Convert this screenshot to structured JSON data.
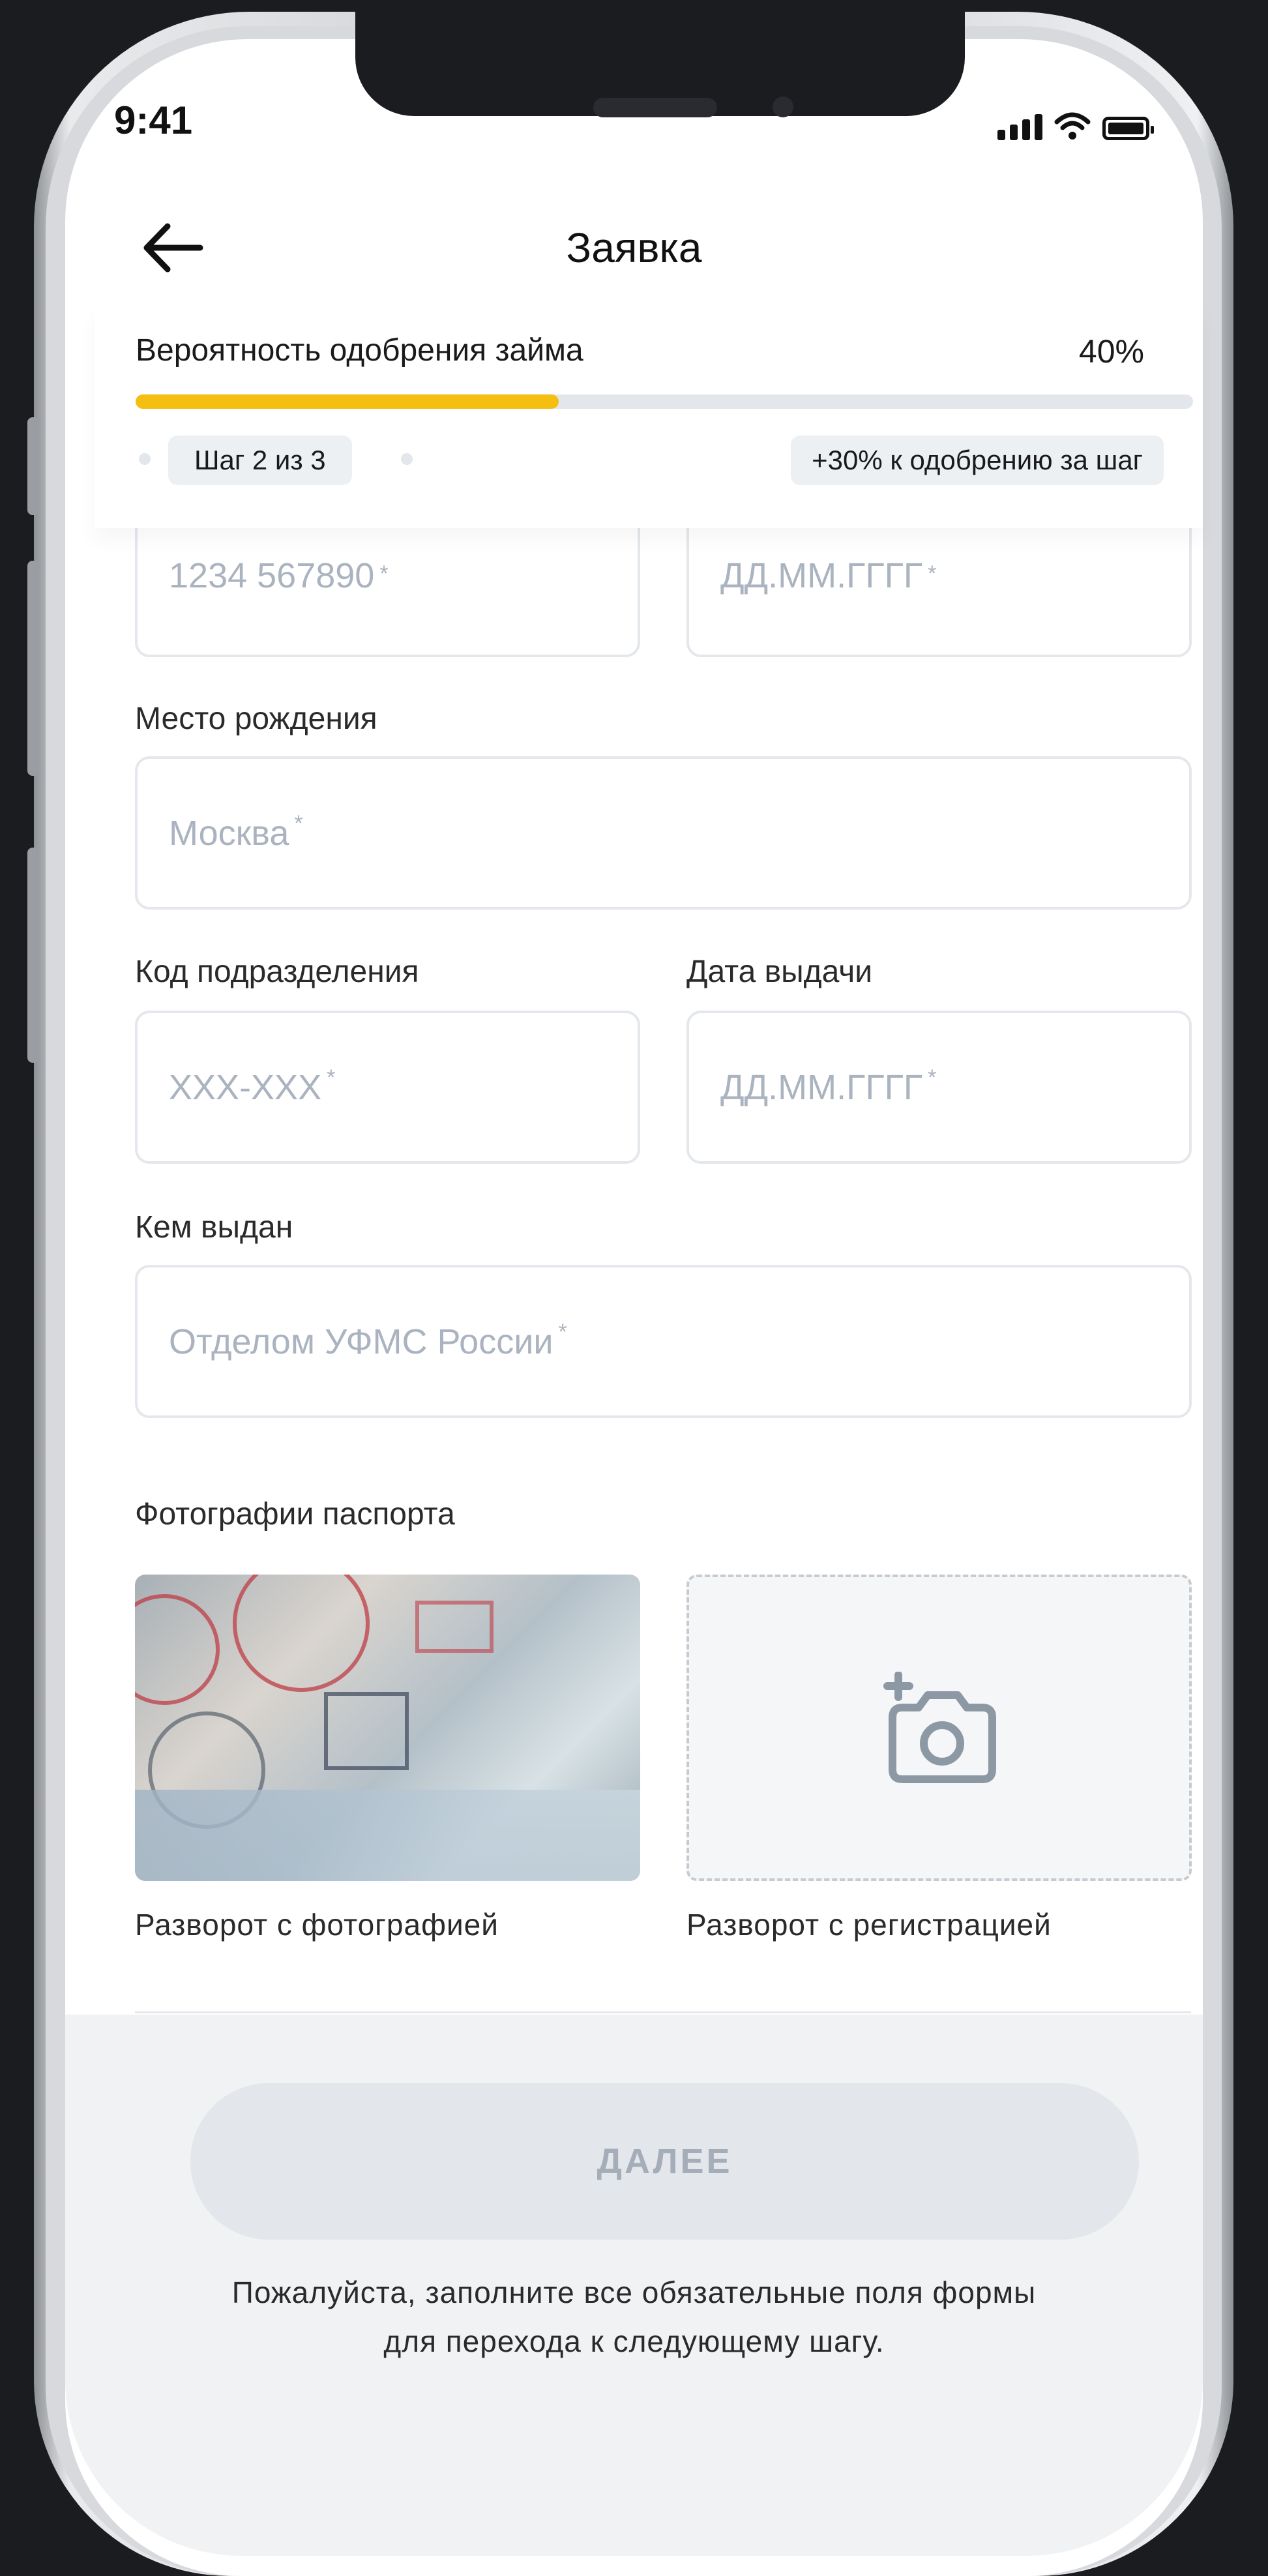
{
  "status_bar": {
    "time": "9:41"
  },
  "header": {
    "title": "Заявка"
  },
  "progress": {
    "label": "Вероятность одобрения займа",
    "percent_text": "40%",
    "value": 0.4,
    "step": "Шаг 2 из 3",
    "bonus": "+30% к одобрению за шаг"
  },
  "form": {
    "passport_number": {
      "placeholder": "1234 567890"
    },
    "birth_date": {
      "placeholder": "ДД.ММ.ГГГГ"
    },
    "birth_place": {
      "label": "Место рождения",
      "placeholder": "Москва"
    },
    "division_code": {
      "label": "Код подразделения",
      "placeholder": "XXX-XXX"
    },
    "issue_date": {
      "label": "Дата выдачи",
      "placeholder": "ДД.ММ.ГГГГ"
    },
    "issued_by": {
      "label": "Кем выдан",
      "placeholder": "Отделом УФМС России"
    },
    "required_mark": "*"
  },
  "photos": {
    "title": "Фотографии паспорта",
    "photo_page_caption": "Разворот с фотографией",
    "registration_page_caption": "Разворот с регистрацией",
    "upload_icon": "add-photo-camera-icon"
  },
  "footer": {
    "next_label": "ДАЛЕЕ",
    "hint_line1": "Пожалуйста, заполните все обязательные поля формы",
    "hint_line2": "для перехода к следующему шагу."
  },
  "colors": {
    "progress_fill": "#f4bf11",
    "track": "#e3e6ea",
    "placeholder": "#aab3bf",
    "button_disabled": "#e3e6ea"
  }
}
